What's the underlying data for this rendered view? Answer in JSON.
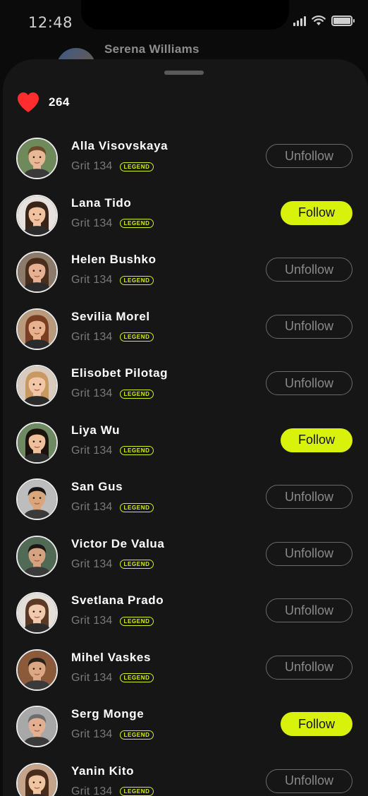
{
  "status_bar": {
    "time": "12:48",
    "icons": [
      "signal-icon",
      "wifi-icon",
      "battery-icon"
    ]
  },
  "background_header": {
    "name": "Serena Williams"
  },
  "likes": {
    "icon": "heart-icon",
    "count": "264",
    "color": "#ff2d2d"
  },
  "accent_color": "#d9f20c",
  "users": [
    {
      "name": "Alla Visovskaya",
      "grit": "Grit 134",
      "badge": "LEGEND",
      "button": "Unfollow",
      "following": true
    },
    {
      "name": "Lana Tido",
      "grit": "Grit 134",
      "badge": "LEGEND",
      "button": "Follow",
      "following": false
    },
    {
      "name": "Helen Bushko",
      "grit": "Grit 134",
      "badge": "LEGEND",
      "button": "Unfollow",
      "following": true
    },
    {
      "name": "Sevilia Morel",
      "grit": "Grit 134",
      "badge": "LEGEND",
      "button": "Unfollow",
      "following": true
    },
    {
      "name": "Elisobet Pilotag",
      "grit": "Grit 134",
      "badge": "LEGEND",
      "button": "Unfollow",
      "following": true
    },
    {
      "name": "Liya Wu",
      "grit": "Grit 134",
      "badge": "LEGEND",
      "button": "Follow",
      "following": false
    },
    {
      "name": "San Gus",
      "grit": "Grit 134",
      "badge": "LEGEND",
      "button": "Unfollow",
      "following": true
    },
    {
      "name": "Victor De Valua",
      "grit": "Grit 134",
      "badge": "LEGEND",
      "button": "Unfollow",
      "following": true
    },
    {
      "name": "Svetlana Prado",
      "grit": "Grit 134",
      "badge": "LEGEND",
      "button": "Unfollow",
      "following": true
    },
    {
      "name": "Mihel Vaskes",
      "grit": "Grit 134",
      "badge": "LEGEND",
      "button": "Unfollow",
      "following": true
    },
    {
      "name": "Serg Monge",
      "grit": "Grit 134",
      "badge": "LEGEND",
      "button": "Follow",
      "following": false
    },
    {
      "name": "Yanin Kito",
      "grit": "Grit 134",
      "badge": "LEGEND",
      "button": "Unfollow",
      "following": true
    }
  ]
}
